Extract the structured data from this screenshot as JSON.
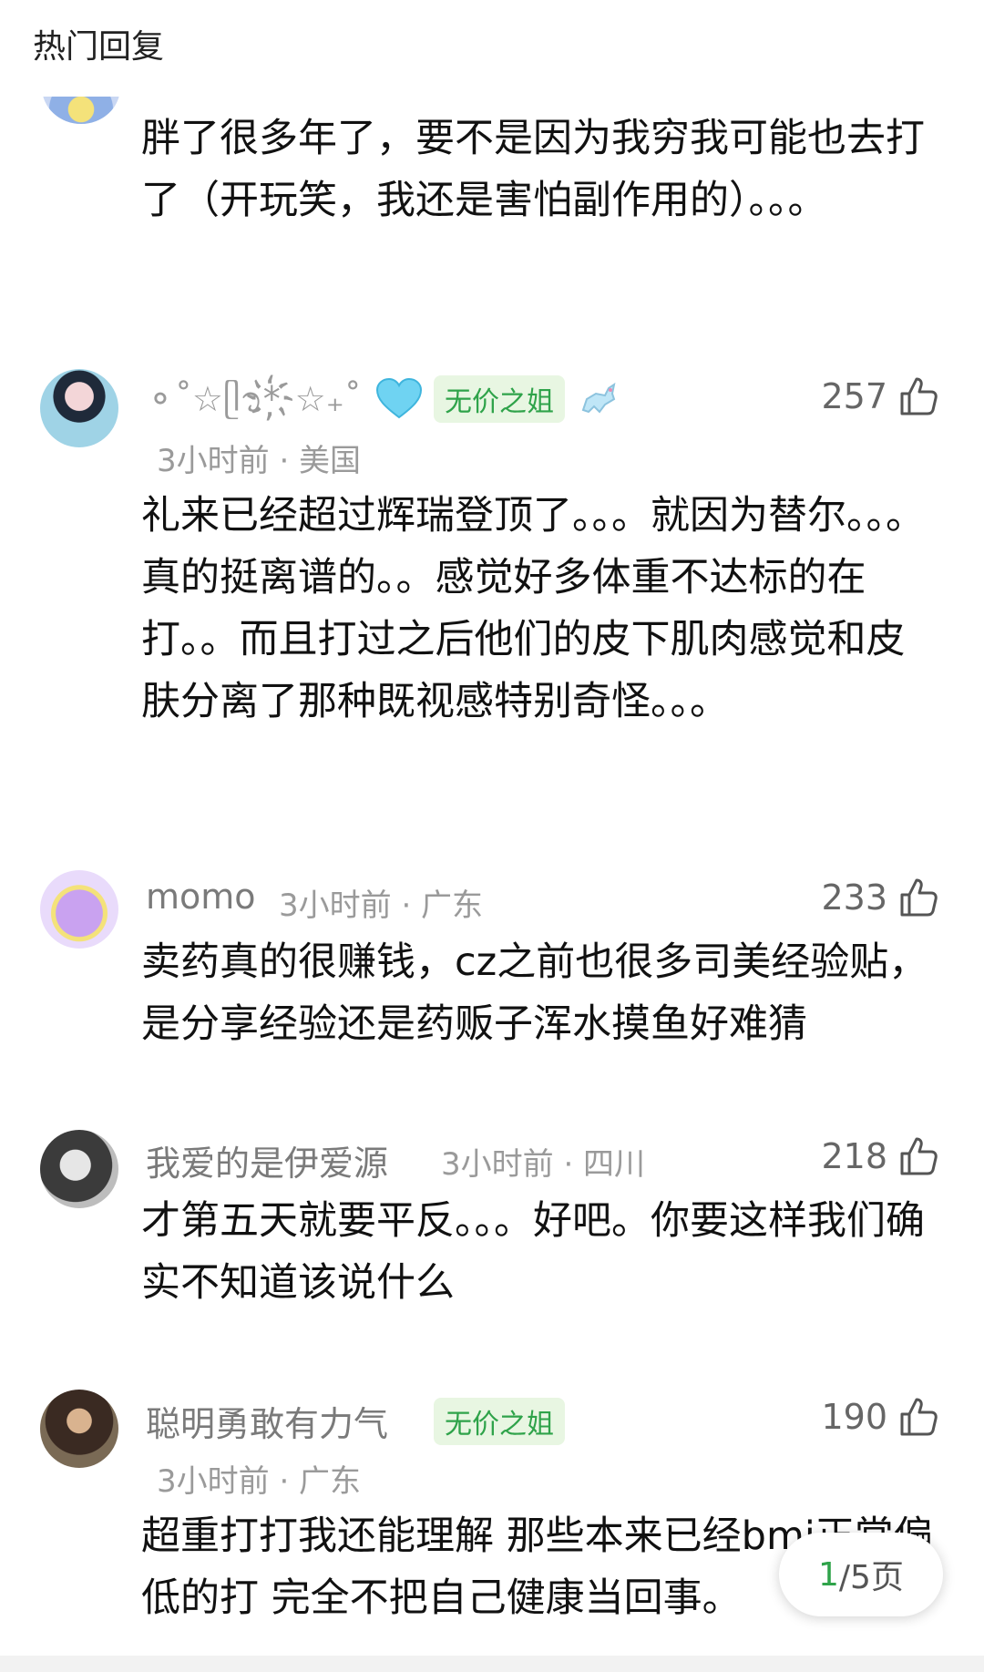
{
  "section_title": "热门回复",
  "comments": [
    {
      "text": "胖了很多年了，要不是因为我穷我可能也去打了（开玩笑，我还是害怕副作用的）。。。"
    },
    {
      "name": "⚬˚☆ᥫ᭡*҉☆₊˚",
      "badge": "无价之姐",
      "likes": "257",
      "meta": "3小时前 · 美国",
      "text": "礼来已经超过辉瑞登顶了。。。就因为替尔。。。真的挺离谱的。。感觉好多体重不达标的在打。。而且打过之后他们的皮下肌肉感觉和皮肤分离了那种既视感特别奇怪。。。"
    },
    {
      "name": "momo",
      "likes": "233",
      "meta": "3小时前 · 广东",
      "text": "卖药真的很赚钱，cz之前也很多司美经验贴，是分享经验还是药贩子浑水摸鱼好难猜"
    },
    {
      "name": "我爱的是伊爱源",
      "likes": "218",
      "meta": "3小时前 · 四川",
      "text": "才第五天就要平反。。。好吧。你要这样我们确实不知道该说什么"
    },
    {
      "name": "聪明勇敢有力气",
      "badge": "无价之姐",
      "likes": "190",
      "meta": "3小时前 · 广东",
      "text": "超重打打我还能理解 那些本来已经bmi正常偏低的打 完全不把自己健康当回事。"
    }
  ],
  "pager": {
    "current": "1",
    "rest": "/5页"
  },
  "colors": {
    "badge_green": "#2fa34a",
    "text_gray": "#9a9a9a"
  }
}
